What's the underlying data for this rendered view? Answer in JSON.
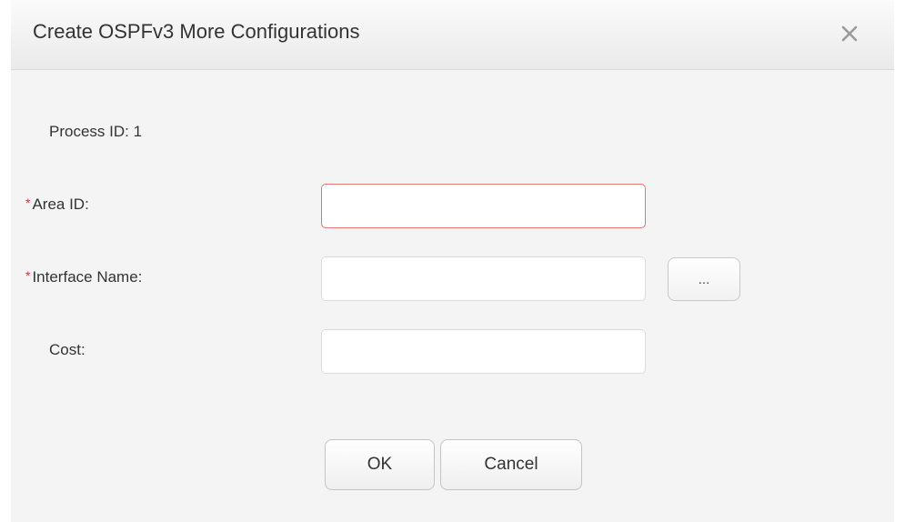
{
  "dialog": {
    "title": "Create OSPFv3 More Configurations",
    "close_icon": "close-icon"
  },
  "form": {
    "process_id_label": "Process ID: 1",
    "required_mark": "*",
    "area_id": {
      "label": "Area ID:",
      "value": "",
      "placeholder": "",
      "invalid": true
    },
    "interface_name": {
      "label": "Interface Name:",
      "value": "",
      "placeholder": "",
      "browse_label": "..."
    },
    "cost": {
      "label": "Cost:",
      "value": "",
      "placeholder": ""
    }
  },
  "buttons": {
    "ok_label": "OK",
    "cancel_label": "Cancel"
  },
  "colors": {
    "required": "#e0302a",
    "invalid_border": "#e57575",
    "header_bg": "#eeeeee",
    "body_bg": "#f4f4f4"
  }
}
